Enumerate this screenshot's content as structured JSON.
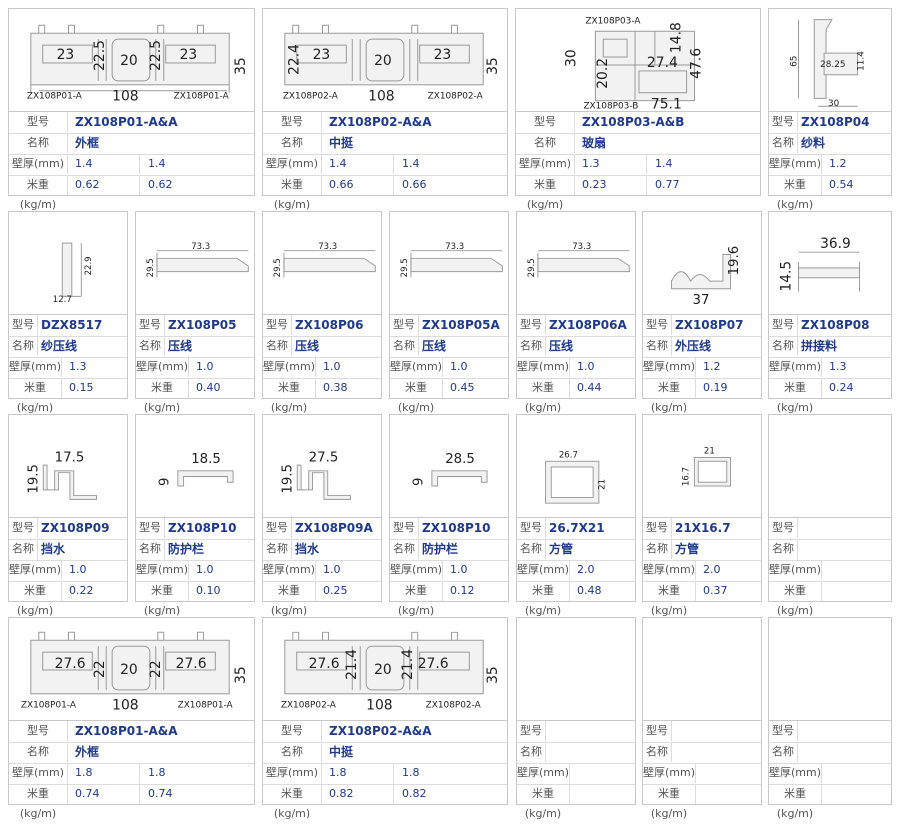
{
  "labels": {
    "model": "型号",
    "name": "名称",
    "thickness": "壁厚(mm)",
    "weight": "米重(kg/m)"
  },
  "cards": [
    {
      "code": "ZX108P01-A&A",
      "name": "外框",
      "t1": "1.4",
      "t2": "1.4",
      "w1": "0.62",
      "w2": "0.62",
      "dims": {
        "a": "23",
        "b": "20",
        "c": "23",
        "d": "22.5",
        "e": "22.5",
        "h": "35",
        "w": "108",
        "l1": "ZX108P01-A",
        "l2": "ZX108P01-A"
      }
    },
    {
      "code": "ZX108P02-A&A",
      "name": "中挺",
      "t1": "1.4",
      "t2": "1.4",
      "w1": "0.66",
      "w2": "0.66",
      "dims": {
        "a": "23",
        "b": "20",
        "c": "23",
        "d": "22.4",
        "h": "35",
        "w": "108",
        "l1": "ZX108P02-A",
        "l2": "ZX108P02-A"
      }
    },
    {
      "code": "ZX108P03-A&B",
      "name": "玻扇",
      "t1": "1.3",
      "t2": "1.4",
      "w1": "0.23",
      "w2": "0.77",
      "dims": {
        "top": "ZX108P03-A",
        "bot": "ZX108P03-B",
        "a": "30",
        "b": "20.2",
        "c": "27.4",
        "d": "14.8",
        "e": "47.6",
        "w": "75.1"
      }
    },
    {
      "code": "ZX108P04",
      "name": "纱料",
      "t1": "1.2",
      "w1": "0.54",
      "dims": {
        "h": "65",
        "a": "28.25",
        "b": "11.4",
        "w": "30"
      }
    },
    {
      "code": "DZX8517",
      "name": "纱压线",
      "t1": "1.3",
      "w1": "0.15",
      "dims": {
        "h": "22.9",
        "w": "12.7"
      }
    },
    {
      "code": "ZX108P05",
      "name": "压线",
      "t1": "1.0",
      "w1": "0.40",
      "dims": {
        "w": "73.3",
        "h": "29.5"
      }
    },
    {
      "code": "ZX108P06",
      "name": "压线",
      "t1": "1.0",
      "w1": "0.38",
      "dims": {
        "w": "73.3",
        "h": "29.5"
      }
    },
    {
      "code": "ZX108P05A",
      "name": "压线",
      "t1": "1.0",
      "w1": "0.45",
      "dims": {
        "w": "73.3",
        "h": "29.5"
      }
    },
    {
      "code": "ZX108P06A",
      "name": "压线",
      "t1": "1.0",
      "w1": "0.44",
      "dims": {
        "w": "73.3",
        "h": "29.5"
      }
    },
    {
      "code": "ZX108P07",
      "name": "外压线",
      "t1": "1.2",
      "w1": "0.19",
      "dims": {
        "h": "19.6",
        "w": "37"
      }
    },
    {
      "code": "ZX108P08",
      "name": "拼接料",
      "t1": "1.3",
      "w1": "0.24",
      "dims": {
        "w": "36.9",
        "h": "14.5"
      }
    },
    {
      "code": "ZX108P09",
      "name": "挡水",
      "t1": "1.0",
      "w1": "0.22",
      "dims": {
        "w": "17.5",
        "h": "19.5"
      }
    },
    {
      "code": "ZX108P10",
      "name": "防护栏",
      "t1": "1.0",
      "w1": "0.10",
      "dims": {
        "w": "18.5",
        "h": "9"
      }
    },
    {
      "code": "ZX108P09A",
      "name": "挡水",
      "t1": "1.0",
      "w1": "0.25",
      "dims": {
        "w": "27.5",
        "h": "19.5"
      }
    },
    {
      "code": "ZX108P10",
      "name": "防护栏",
      "t1": "1.0",
      "w1": "0.12",
      "dims": {
        "w": "28.5",
        "h": "9"
      }
    },
    {
      "code": "26.7X21",
      "name": "方管",
      "t1": "2.0",
      "w1": "0.48",
      "dims": {
        "w": "26.7",
        "h": "21"
      }
    },
    {
      "code": "21X16.7",
      "name": "方管",
      "t1": "2.0",
      "w1": "0.37",
      "dims": {
        "w": "21",
        "h": "16.7"
      }
    },
    {
      "code": "",
      "name": "",
      "t1": "",
      "w1": ""
    },
    {
      "code": "ZX108P01-A&A",
      "name": "外框",
      "t1": "1.8",
      "t2": "1.8",
      "w1": "0.74",
      "w2": "0.74",
      "dims": {
        "a": "27.6",
        "b": "20",
        "c": "27.6",
        "d": "22",
        "e": "22",
        "h": "35",
        "w": "108",
        "l1": "ZX108P01-A",
        "l2": "ZX108P01-A"
      }
    },
    {
      "code": "ZX108P02-A&A",
      "name": "中挺",
      "t1": "1.8",
      "t2": "1.8",
      "w1": "0.82",
      "w2": "0.82",
      "dims": {
        "a": "27.6",
        "b": "20",
        "c": "27.6",
        "d": "21.4",
        "e": "21.4",
        "h": "35",
        "w": "108",
        "l1": "ZX108P02-A",
        "l2": "ZX108P02-A"
      }
    },
    {
      "code": "",
      "name": "",
      "t1": "",
      "w1": ""
    },
    {
      "code": "",
      "name": "",
      "t1": "",
      "w1": ""
    },
    {
      "code": "",
      "name": "",
      "t1": "",
      "w1": ""
    }
  ]
}
